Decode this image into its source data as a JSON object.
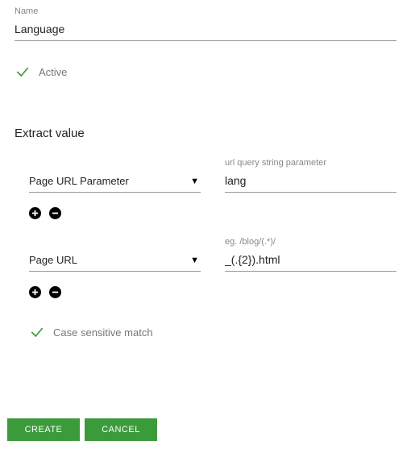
{
  "name": {
    "label": "Name",
    "value": "Language"
  },
  "active": {
    "label": "Active",
    "checked": true
  },
  "section_heading": "Extract value",
  "rows": [
    {
      "select": "Page URL Parameter",
      "input_label": "url query string parameter",
      "input_value": "lang"
    },
    {
      "select": "Page URL",
      "input_label": "eg. /blog/(.*)/",
      "input_value": "_(.{2}).html"
    }
  ],
  "case_sensitive": {
    "label": "Case sensitive match",
    "checked": true
  },
  "buttons": {
    "create": "CREATE",
    "cancel": "CANCEL"
  }
}
